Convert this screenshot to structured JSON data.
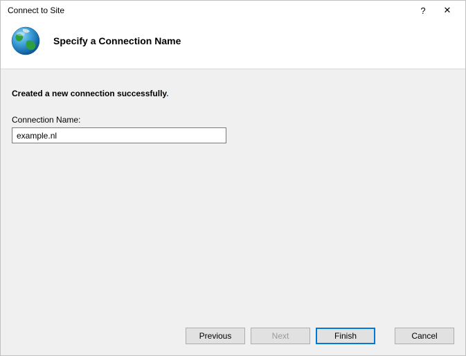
{
  "window": {
    "title": "Connect to Site"
  },
  "header": {
    "title": "Specify a Connection Name"
  },
  "content": {
    "status_text": "Created a new connection successfully",
    "field_label": "Connection Name:",
    "connection_name_value": "example.nl"
  },
  "buttons": {
    "previous": "Previous",
    "next": "Next",
    "finish": "Finish",
    "cancel": "Cancel"
  }
}
